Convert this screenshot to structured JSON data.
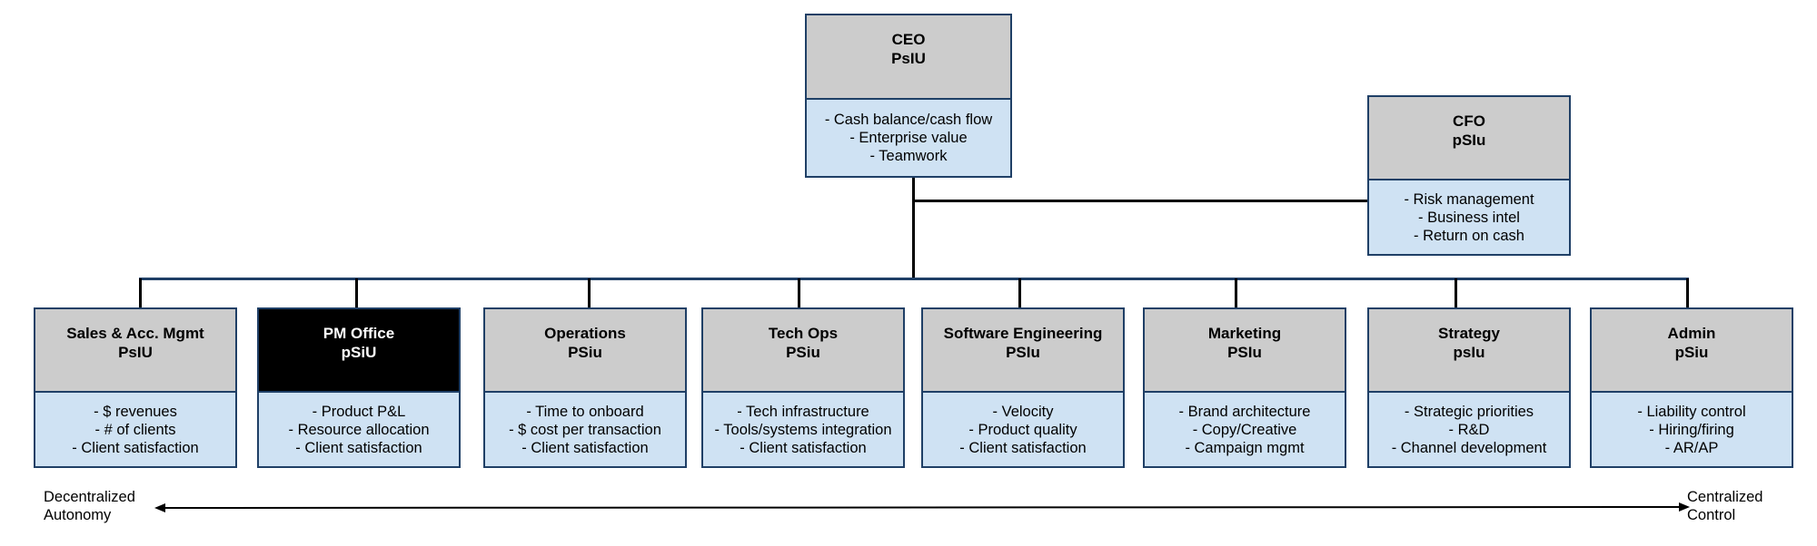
{
  "ceo": {
    "title": "CEO",
    "code": "PsIU",
    "items": [
      "- Cash balance/cash flow",
      "- Enterprise value",
      "- Teamwork"
    ]
  },
  "cfo": {
    "title": "CFO",
    "code": "pSIu",
    "items": [
      "- Risk management",
      "- Business intel",
      "- Return on cash"
    ]
  },
  "departments": [
    {
      "title": "Sales & Acc. Mgmt",
      "code": "PsIU",
      "items": [
        "- $ revenues",
        "- # of clients",
        "- Client satisfaction"
      ]
    },
    {
      "title": "PM Office",
      "code": "pSiU",
      "items": [
        "- Product P&L",
        "- Resource allocation",
        "- Client satisfaction"
      ],
      "highlight": "#000000"
    },
    {
      "title": "Operations",
      "code": "PSiu",
      "items": [
        "- Time to onboard",
        "- $ cost per transaction",
        "- Client satisfaction"
      ]
    },
    {
      "title": "Tech Ops",
      "code": "PSiu",
      "items": [
        "- Tech infrastructure",
        "- Tools/systems integration",
        "- Client satisfaction"
      ]
    },
    {
      "title": "Software Engineering",
      "code": "PSIu",
      "items": [
        "- Velocity",
        "- Product quality",
        "- Client satisfaction"
      ]
    },
    {
      "title": "Marketing",
      "code": "PSIu",
      "items": [
        "- Brand architecture",
        "- Copy/Creative",
        "- Campaign mgmt"
      ]
    },
    {
      "title": "Strategy",
      "code": "psIu",
      "items": [
        "- Strategic priorities",
        "- R&D",
        "- Channel development"
      ]
    },
    {
      "title": "Admin",
      "code": "pSiu",
      "items": [
        "- Liability control",
        "- Hiring/firing",
        "- AR/AP"
      ]
    }
  ],
  "axis": {
    "left": [
      "Decentralized",
      "Autonomy"
    ],
    "right": [
      "Centralized",
      "Control"
    ]
  },
  "colors": {
    "header": "#cccccc",
    "body": "#cfe2f3",
    "border": "#1f3f66",
    "highlight": "#000000"
  }
}
